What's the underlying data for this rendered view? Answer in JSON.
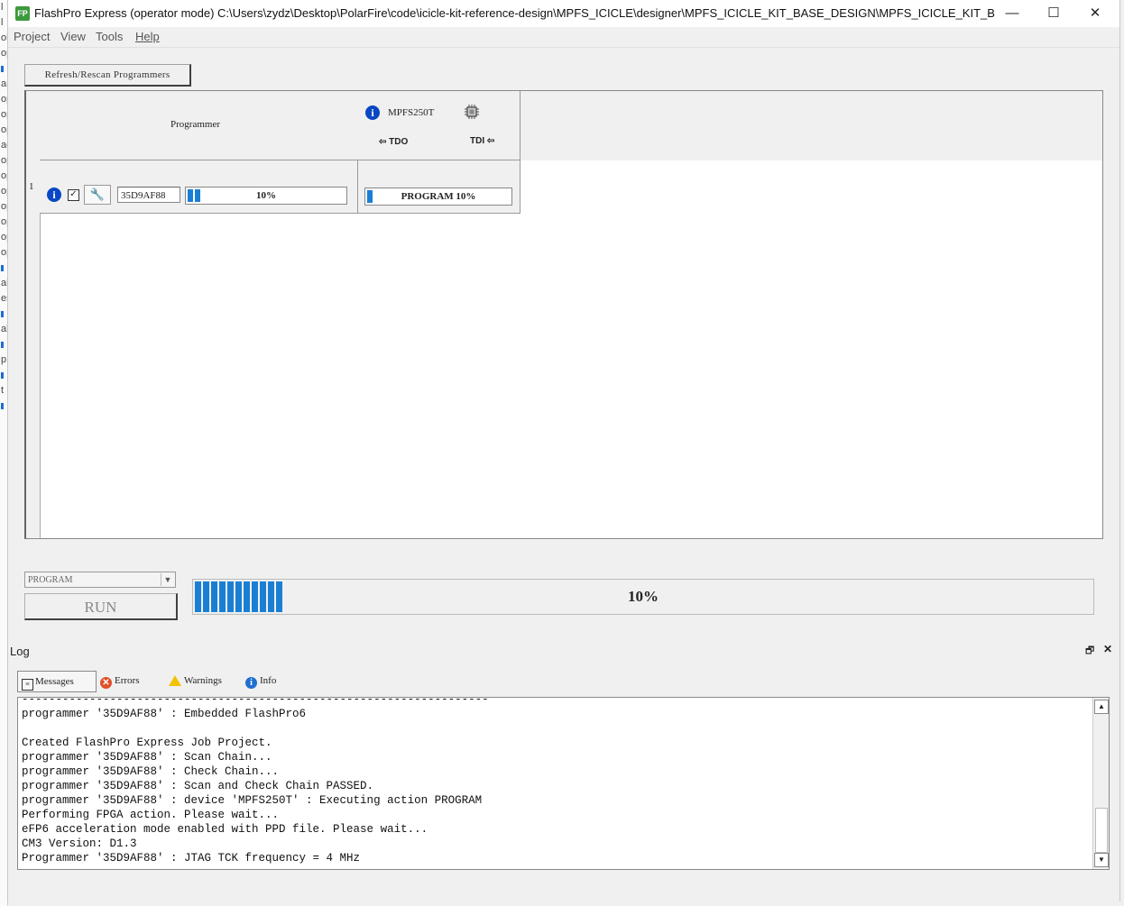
{
  "window": {
    "app_icon": "FP",
    "title": "FlashPro Express (operator mode)   C:\\Users\\zydz\\Desktop\\PolarFire\\code\\icicle-kit-reference-design\\MPFS_ICICLE\\designer\\MPFS_ICICLE_KIT_BASE_DESIGN\\MPFS_ICICLE_KIT_BASE_DESIGN_fp\\MPFS_...",
    "minimize": "—",
    "maximize": "☐",
    "close": "✕"
  },
  "menu": [
    "Project",
    "View",
    "Tools",
    "Help"
  ],
  "toolbar": {
    "refresh_label": "Refresh/Rescan Programmers"
  },
  "grid": {
    "programmer_header": "Programmer",
    "device": {
      "name": "MPFS250T",
      "tdo": "⇦ TDO",
      "tdi": "TDI ⇦"
    },
    "rows": [
      {
        "index": "1",
        "programmer_id": "35D9AF88",
        "progress_label": "10%",
        "progress": 0.1,
        "device_status": "PROGRAM  10%",
        "device_progress": 0.1
      }
    ]
  },
  "controls": {
    "action_value": "PROGRAM",
    "run_label": "RUN",
    "progress_label": "10%",
    "progress": 0.1,
    "accent_color": "#1a7fd4"
  },
  "log": {
    "title": "Log",
    "restore_icon": "🗗",
    "close_icon": "✕",
    "tabs": {
      "messages": "Messages",
      "errors": "Errors",
      "warnings": "Warnings",
      "info": "Info"
    },
    "lines": [
      "---------------------------------------------------------------------",
      "programmer '35D9AF88' : Embedded FlashPro6",
      "",
      "Created FlashPro Express Job Project.",
      "programmer '35D9AF88' : Scan Chain...",
      "programmer '35D9AF88' : Check Chain...",
      "programmer '35D9AF88' : Scan and Check Chain PASSED.",
      "programmer '35D9AF88' : device 'MPFS250T' : Executing action PROGRAM",
      "Performing FPGA action. Please wait...",
      "eFP6 acceleration mode enabled with PPD file. Please wait...",
      "CM3 Version: D1.3",
      "Programmer '35D9AF88' : JTAG TCK frequency = 4 MHz"
    ]
  }
}
